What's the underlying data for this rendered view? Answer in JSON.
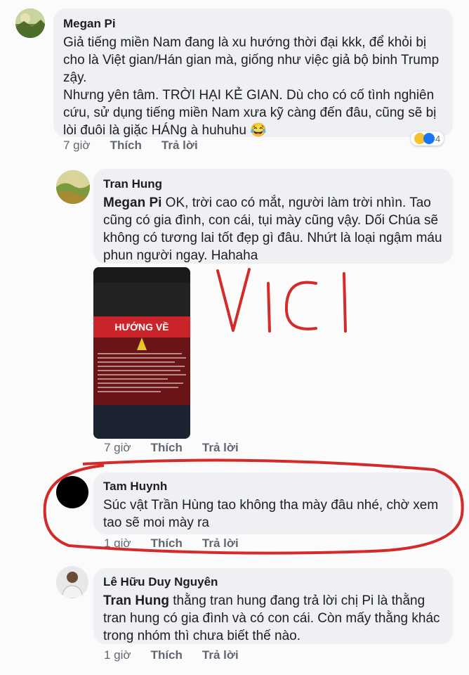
{
  "comments": [
    {
      "name": "Megan Pi",
      "mention": "",
      "text": "Giả tiếng miền Nam đang là xu hướng thời đại kkk, để khỏi bị cho là Việt gian/Hán gian mà, giống như việc giả bộ binh Trump zậy.",
      "text2": "Nhưng yên tâm. TRỜI HẠI KẺ GIAN. Dù cho có cố tình nghiên cứu, sử dụng tiếng miền Nam xưa kỹ càng đến đâu, cũng sẽ bị lòi đuôi là giặc HÁNg à huhuhu 😂",
      "time": "7 giờ",
      "like": "Thích",
      "reply": "Trả lời",
      "reaction_count": "4"
    },
    {
      "name": "Tran Hung",
      "mention": "Megan Pi",
      "text": " OK, trời cao có mắt, người làm trời nhìn. Tao cũng có gia đình, con cái, tụi mày cũng vậy. Dối Chúa sẽ không có tương lai tốt đẹp gì đâu. Nhứt là loại ngậm máu phun người ngay. Hahaha",
      "time": "7 giờ",
      "like": "Thích",
      "reply": "Trả lời"
    },
    {
      "name": "Tam Huynh",
      "mention": "",
      "text": "Súc vật Trần Hùng tao không tha mày đâu nhé, chờ xem tao sẽ moi mày ra",
      "time": "1 giờ",
      "like": "Thích",
      "reply": "Trả lời"
    },
    {
      "name": "Lê Hữu Duy Nguyên",
      "mention": "Tran Hung",
      "text": " thằng tran hung đang trả lời chị Pi là thằng tran hung có gia đình và có con cái. Còn mấy thằng khác trong nhóm thì chưa biết thế nào.",
      "time": "1 giờ",
      "like": "Thích",
      "reply": "Trả lời"
    }
  ],
  "attachment": {
    "banner": "HƯỚNG VỀ"
  },
  "annotation": {
    "text": "VICI",
    "color": "#d42a2a"
  },
  "colors": {
    "bubble": "#eef0f3",
    "action": "#606770"
  }
}
